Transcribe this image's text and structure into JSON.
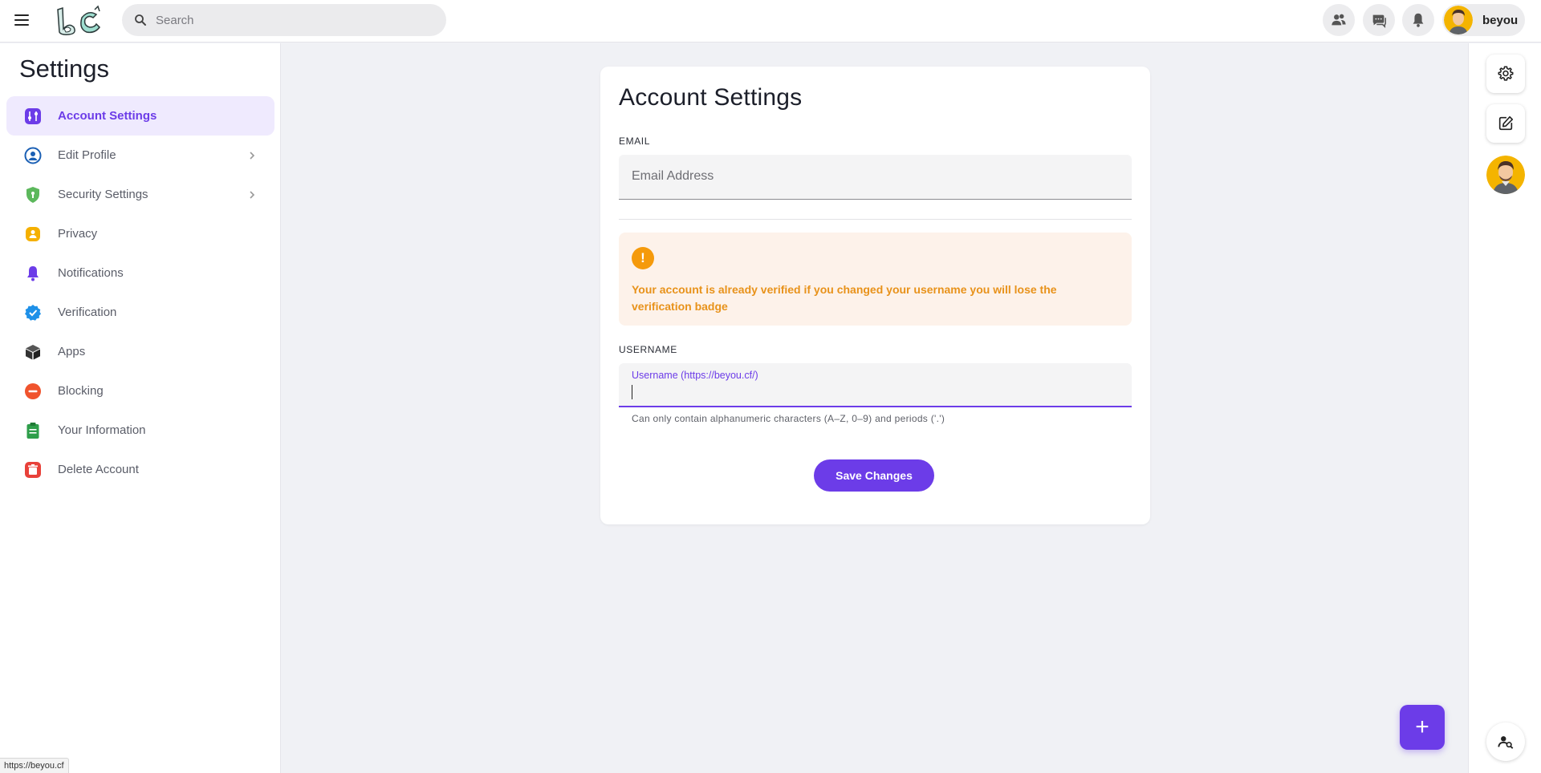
{
  "header": {
    "search_placeholder": "Search",
    "username": "beyou"
  },
  "sidebar": {
    "title": "Settings",
    "items": [
      {
        "label": "Account Settings",
        "icon": "sliders-icon",
        "active": true
      },
      {
        "label": "Edit Profile",
        "icon": "user-circle-icon",
        "has_chevron": true
      },
      {
        "label": "Security Settings",
        "icon": "shield-icon",
        "has_chevron": true
      },
      {
        "label": "Privacy",
        "icon": "privacy-icon"
      },
      {
        "label": "Notifications",
        "icon": "bell-icon"
      },
      {
        "label": "Verification",
        "icon": "verified-badge-icon"
      },
      {
        "label": "Apps",
        "icon": "cube-icon"
      },
      {
        "label": "Blocking",
        "icon": "block-icon"
      },
      {
        "label": "Your Information",
        "icon": "clipboard-icon"
      },
      {
        "label": "Delete Account",
        "icon": "trash-icon"
      }
    ]
  },
  "main": {
    "title": "Account Settings",
    "email_section_label": "EMAIL",
    "email_placeholder": "Email Address",
    "email_value": "",
    "alert_icon_text": "!",
    "alert_text": "Your account is already verified if you changed your username you will lose the verification badge",
    "username_section_label": "USERNAME",
    "username_field_label": "Username (https://beyou.cf/)",
    "username_value": "",
    "username_helper": "Can only contain alphanumeric characters (A–Z, 0–9) and periods ('.')",
    "save_label": "Save Changes"
  },
  "fab_label": "+",
  "status_bar_url": "https://beyou.cf",
  "colors": {
    "accent": "#6c3ce8",
    "alert_bg": "#fdf2ea",
    "alert_text": "#e8921a",
    "page_bg": "#f0f1f5"
  }
}
